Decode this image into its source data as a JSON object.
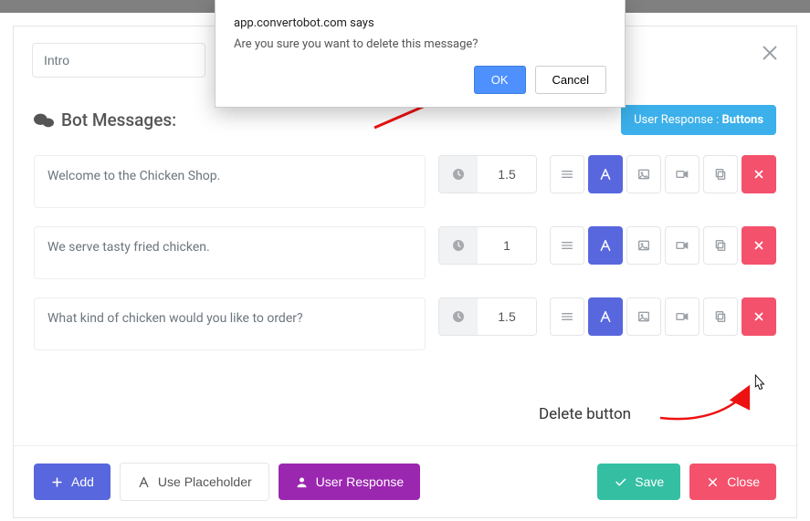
{
  "title_value": "Intro",
  "section_title": "Bot Messages:",
  "user_response_pill": {
    "prefix": "User Response :",
    "mode": "Buttons"
  },
  "messages": [
    {
      "text": "Welcome to the Chicken Shop.",
      "delay": "1.5"
    },
    {
      "text": "We serve tasty fried chicken.",
      "delay": "1"
    },
    {
      "text": "What kind of chicken would you like to order?",
      "delay": "1.5"
    }
  ],
  "annotation_delete": "Delete button",
  "footer": {
    "add": "Add",
    "placeholder": "Use Placeholder",
    "user_response": "User Response",
    "save": "Save",
    "close": "Close"
  },
  "confirm": {
    "host": "app.convertobot.com says",
    "message": "Are you sure you want to delete this message?",
    "ok": "OK",
    "cancel": "Cancel"
  }
}
